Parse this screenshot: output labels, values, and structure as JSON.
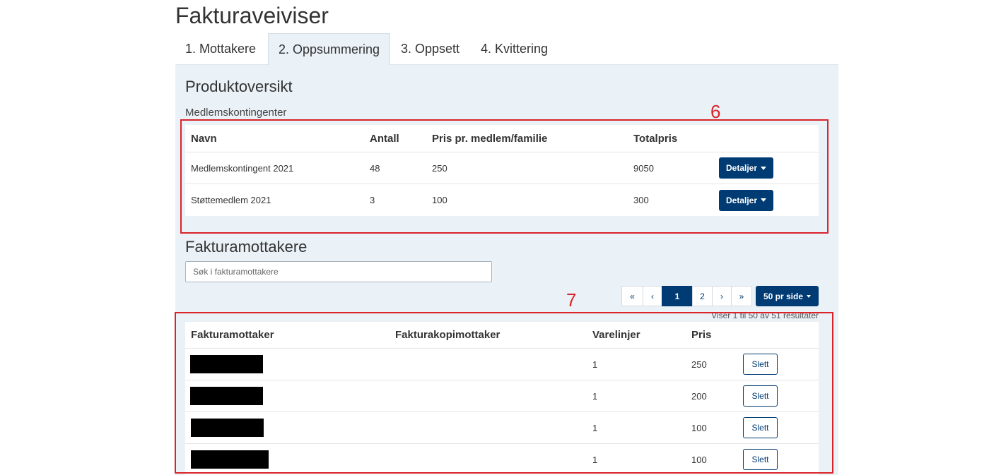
{
  "page": {
    "title": "Fakturaveiviser"
  },
  "tabs": [
    {
      "label": "1. Mottakere"
    },
    {
      "label": "2. Oppsummering"
    },
    {
      "label": "3. Oppsett"
    },
    {
      "label": "4. Kvittering"
    }
  ],
  "active_tab": 1,
  "produktoversikt": {
    "heading": "Produktoversikt",
    "subheading": "Medlemskontingenter",
    "columns": [
      "Navn",
      "Antall",
      "Pris pr. medlem/familie",
      "Totalpris"
    ],
    "rows": [
      {
        "navn": "Medlemskontingent 2021",
        "antall": "48",
        "pris": "250",
        "totalpris": "9050",
        "action": "Detaljer"
      },
      {
        "navn": "Støttemedlem 2021",
        "antall": "3",
        "pris": "100",
        "totalpris": "300",
        "action": "Detaljer"
      }
    ]
  },
  "fakturamottakere": {
    "heading": "Fakturamottakere",
    "search_placeholder": "Søk i fakturamottakere",
    "pagination": {
      "first": "«",
      "prev": "‹",
      "pages": [
        "1",
        "2"
      ],
      "current": "1",
      "next": "›",
      "last": "»"
    },
    "per_page": "50 pr side",
    "results_text": "Viser 1 til 50 av 51 resultater",
    "columns": [
      "Fakturamottaker",
      "Fakturakopimottaker",
      "Varelinjer",
      "Pris"
    ],
    "rows": [
      {
        "varelinjer": "1",
        "pris": "250",
        "action": "Slett"
      },
      {
        "varelinjer": "1",
        "pris": "200",
        "action": "Slett"
      },
      {
        "varelinjer": "1",
        "pris": "100",
        "action": "Slett"
      },
      {
        "varelinjer": "1",
        "pris": "100",
        "action": "Slett"
      }
    ]
  },
  "annotations": [
    {
      "number": "6",
      "color": "#d9242b"
    },
    {
      "number": "7",
      "color": "#d9242b"
    }
  ],
  "colors": {
    "primary": "#003b73",
    "panel_bg": "#eaf1f7",
    "annotation": "#d9242b"
  }
}
